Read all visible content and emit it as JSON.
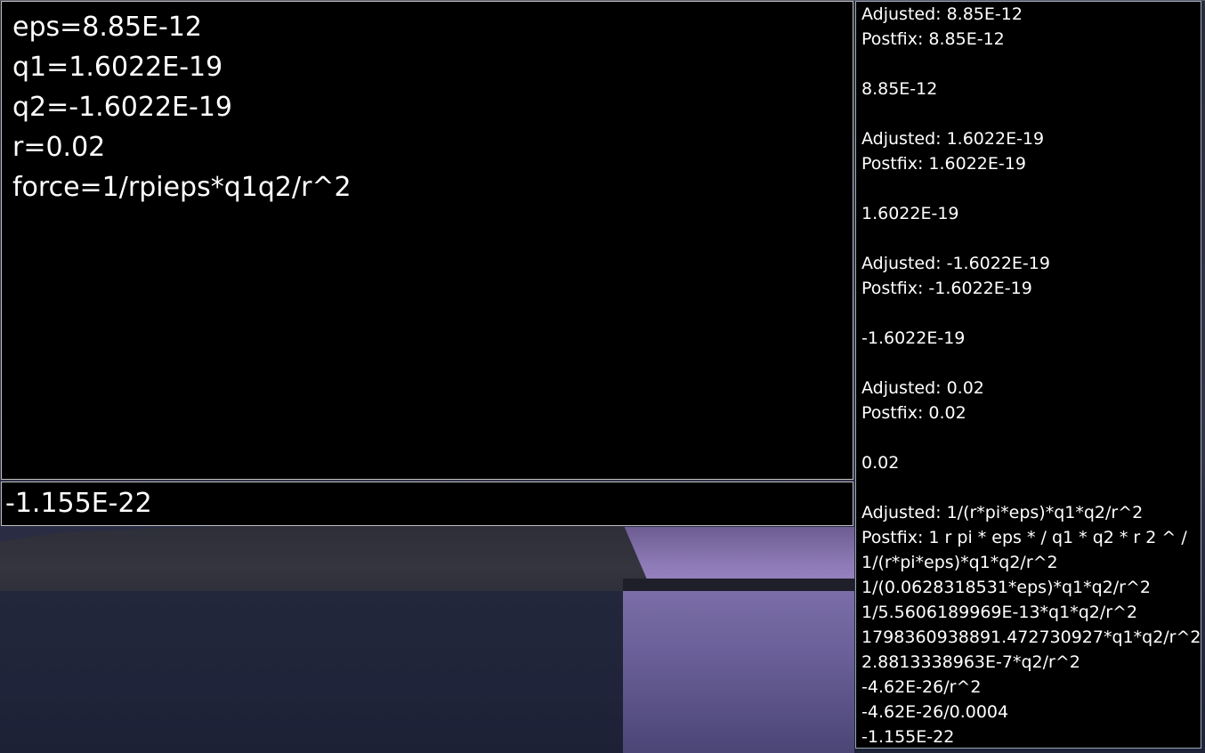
{
  "editor": {
    "lines": [
      "eps=8.85E-12",
      "q1=1.6022E-19",
      "q2=-1.6022E-19",
      "r=0.02",
      "force=1/rpieps*q1q2/r^2"
    ]
  },
  "result": {
    "value": "-1.155E-22"
  },
  "log": {
    "lines": [
      "Adjusted: 8.85E-12",
      "Postfix: 8.85E-12",
      "",
      "8.85E-12",
      "",
      "Adjusted: 1.6022E-19",
      "Postfix: 1.6022E-19",
      "",
      "1.6022E-19",
      "",
      "Adjusted: -1.6022E-19",
      "Postfix: -1.6022E-19",
      "",
      "-1.6022E-19",
      "",
      "Adjusted: 0.02",
      "Postfix: 0.02",
      "",
      "0.02",
      "",
      "Adjusted: 1/(r*pi*eps)*q1*q2/r^2",
      "Postfix: 1 r pi * eps * / q1 * q2 * r 2 ^ /",
      "1/(r*pi*eps)*q1*q2/r^2",
      "1/(0.0628318531*eps)*q1*q2/r^2",
      "1/5.5606189969E-13*q1*q2/r^2",
      "1798360938891.472730927*q1*q2/r^2",
      "2.8813338963E-7*q2/r^2",
      "-4.62E-26/r^2",
      "-4.62E-26/0.0004",
      "-1.155E-22"
    ]
  }
}
